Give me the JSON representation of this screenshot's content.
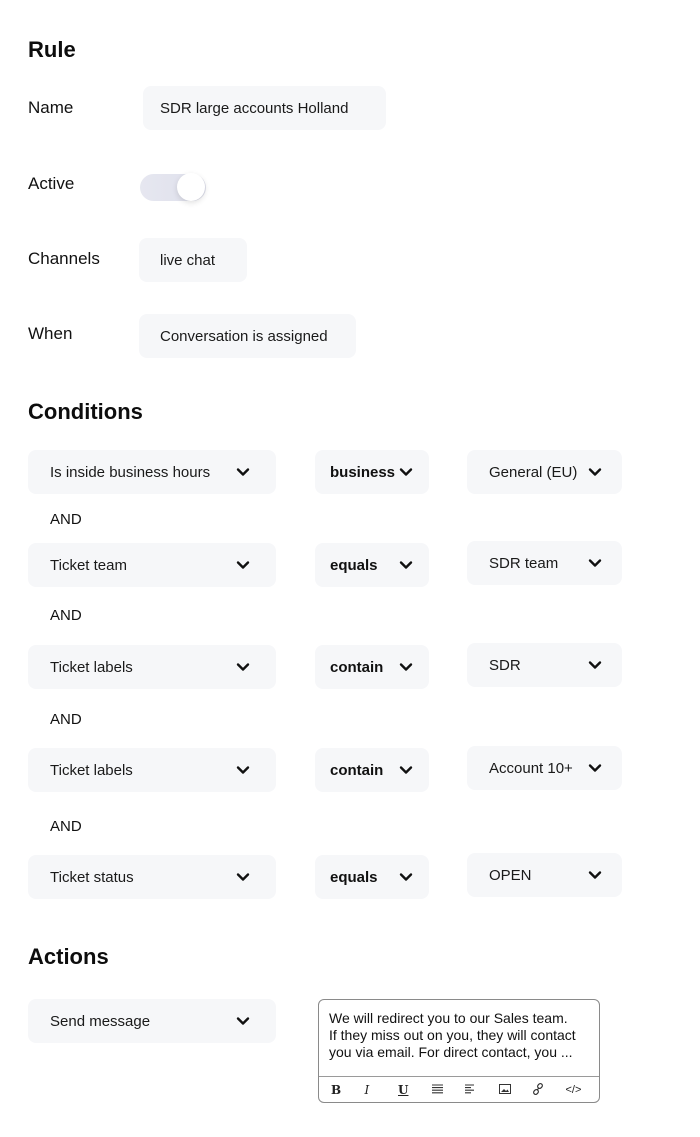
{
  "rule": {
    "heading": "Rule",
    "name_label": "Name",
    "name_value": "SDR large accounts Holland",
    "active_label": "Active",
    "active_on": true,
    "channels_label": "Channels",
    "channels_value": "live chat",
    "when_label": "When",
    "when_value": "Conversation is assigned"
  },
  "conditions": {
    "heading": "Conditions",
    "connector": "AND",
    "rows": [
      {
        "field": "Is inside business hours",
        "operator": "business",
        "value": "General (EU)"
      },
      {
        "field": "Ticket team",
        "operator": "equals",
        "value": "SDR team"
      },
      {
        "field": "Ticket labels",
        "operator": "contain",
        "value": "SDR"
      },
      {
        "field": "Ticket labels",
        "operator": "contain",
        "value": "Account 10+"
      },
      {
        "field": "Ticket status",
        "operator": "equals",
        "value": "OPEN"
      }
    ]
  },
  "actions": {
    "heading": "Actions",
    "action": "Send message",
    "message_lines": [
      "We will redirect you to our Sales team.",
      "If they miss out on you, they will contact",
      "you via email. For direct contact, you ..."
    ],
    "toolbar": [
      {
        "icon": "bold-icon",
        "glyph": "B"
      },
      {
        "icon": "italic-icon",
        "glyph": "I"
      },
      {
        "icon": "underline-icon",
        "glyph": "U"
      },
      {
        "icon": "justify-icon",
        "glyph": "≣"
      },
      {
        "icon": "align-left-icon",
        "glyph": "☰"
      },
      {
        "icon": "image-icon",
        "glyph": "▣"
      },
      {
        "icon": "link-icon",
        "glyph": "🔗"
      },
      {
        "icon": "code-icon",
        "glyph": "</>"
      }
    ]
  }
}
